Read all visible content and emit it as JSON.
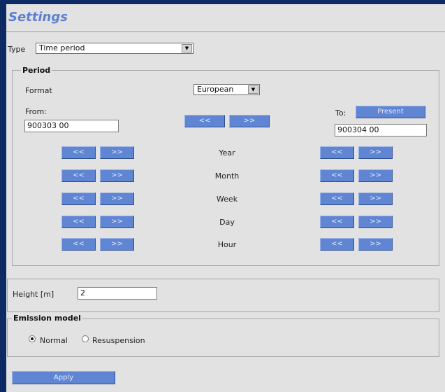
{
  "title": "Settings",
  "type_field": {
    "label": "Type",
    "value": "Time period"
  },
  "period": {
    "legend": "Period",
    "format_label": "Format",
    "format_value": "European",
    "from_label": "From:",
    "from_value": "900303 00",
    "to_label": "To:",
    "to_value": "900304 00",
    "present_label": "Present",
    "prev_label": "<<",
    "next_label": ">>",
    "units": [
      "Year",
      "Month",
      "Week",
      "Day",
      "Hour"
    ]
  },
  "height": {
    "label": "Height [m]",
    "value": "2"
  },
  "emission": {
    "legend": "Emission model",
    "options": [
      "Normal",
      "Resuspension"
    ],
    "selected": "Normal"
  },
  "apply_label": "Apply"
}
